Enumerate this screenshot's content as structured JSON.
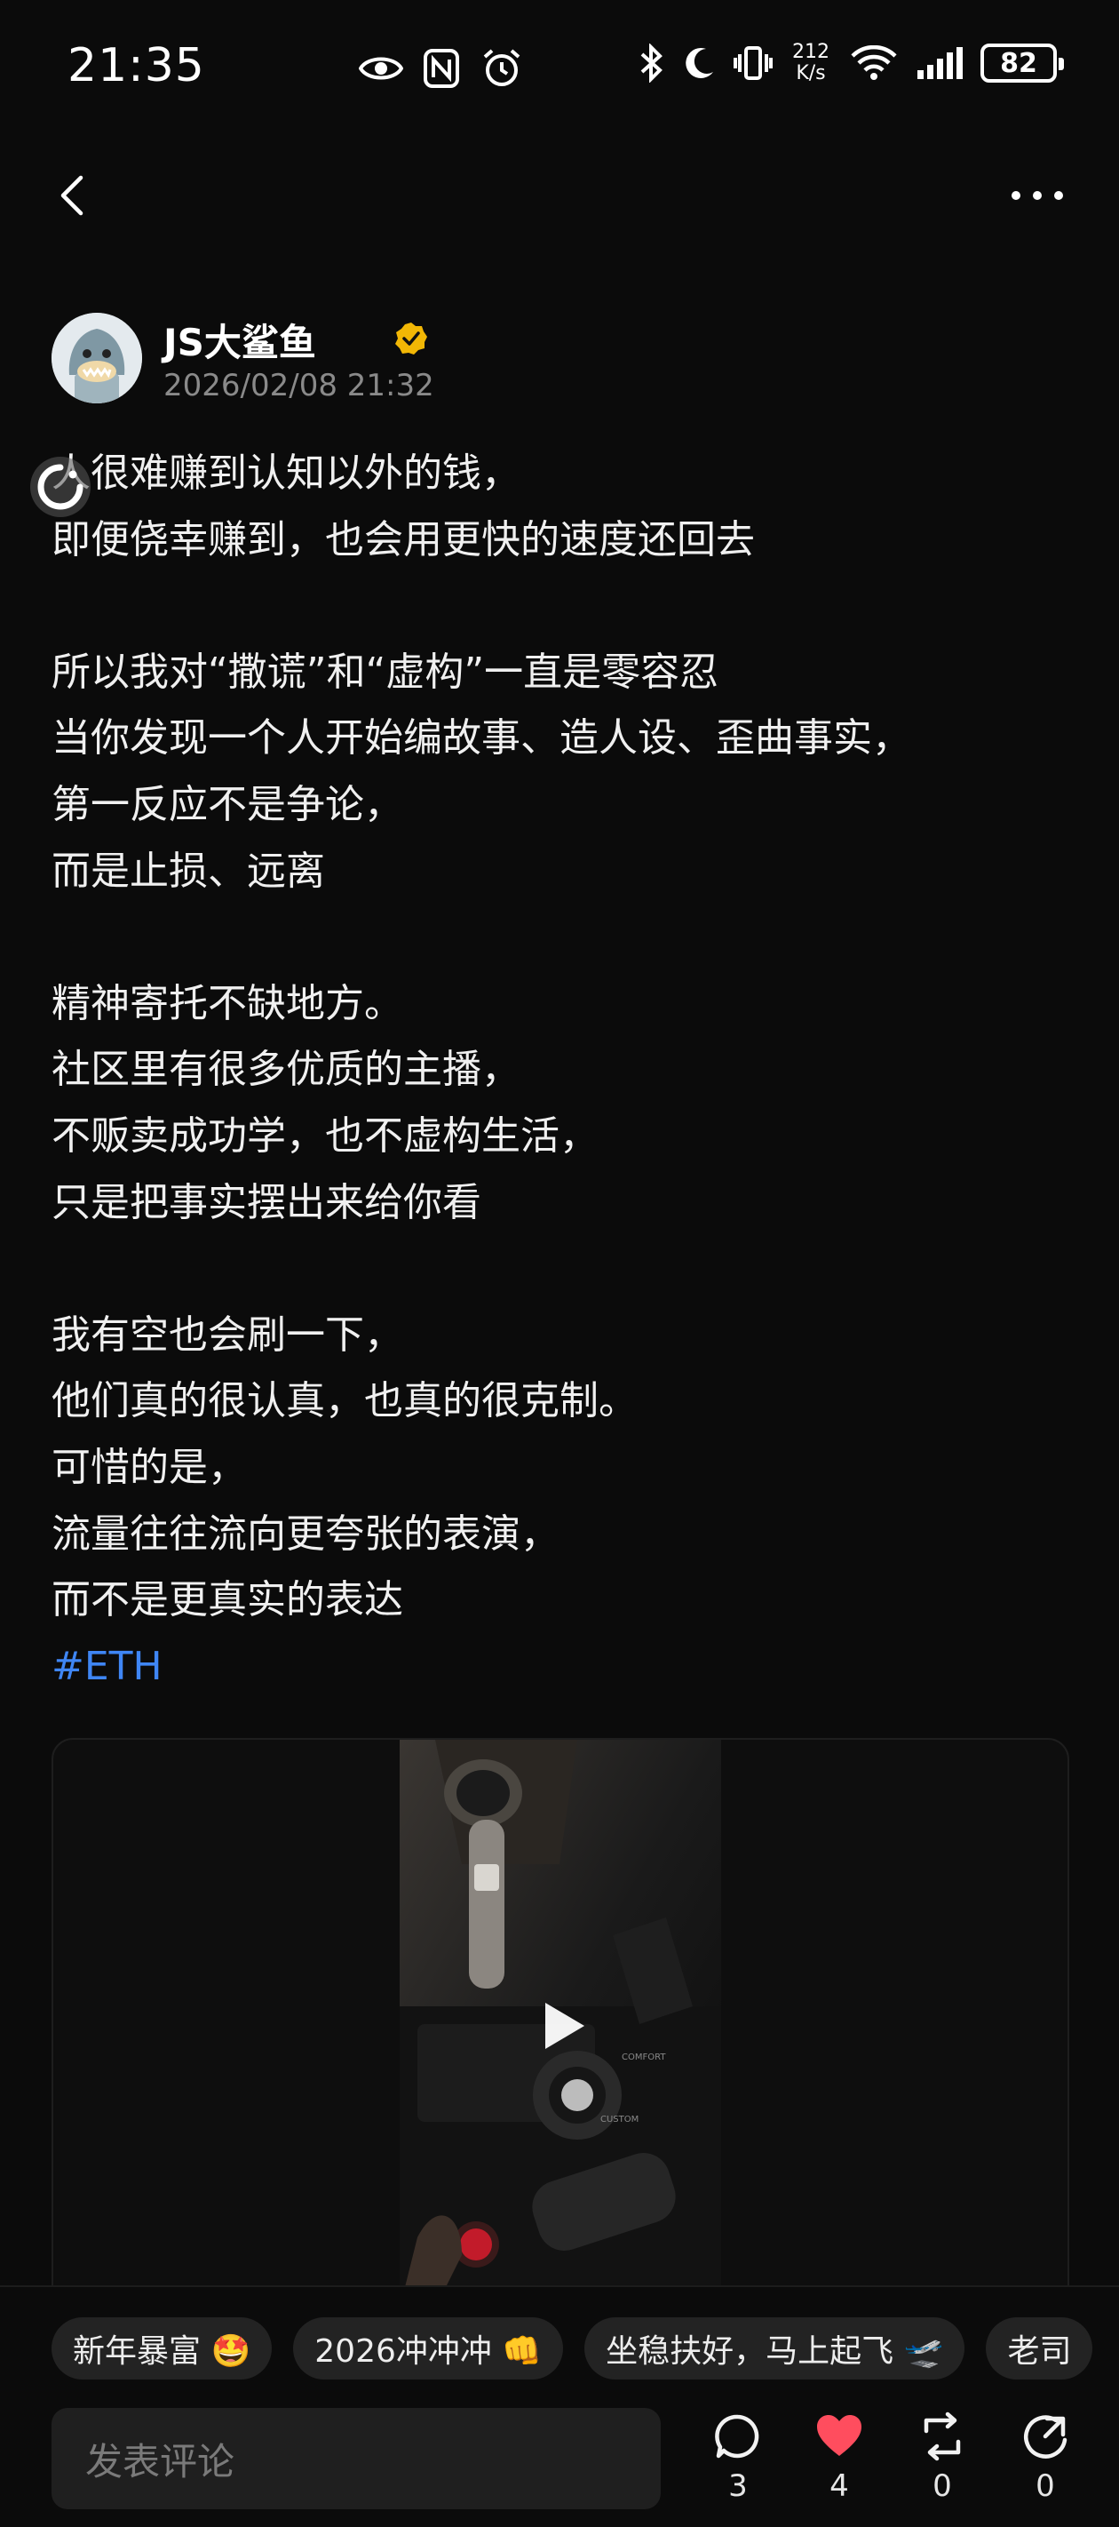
{
  "status_bar": {
    "time": "21:35",
    "net_speed_value": "212",
    "net_speed_unit": "K/s",
    "battery": "82",
    "icons": [
      "eye-icon",
      "nfc-icon",
      "alarm-icon",
      "bluetooth-icon",
      "moon-icon",
      "vibrate-icon",
      "wifi-icon",
      "signal-icon",
      "battery-icon"
    ]
  },
  "nav": {
    "back_icon": "chevron-left-icon",
    "more_icon": "more-dots-icon"
  },
  "author": {
    "name": "JS大鲨鱼",
    "time": "2026/02/08 21:32",
    "verified_color": "#f2b705"
  },
  "post": {
    "lines": [
      "人很难赚到认知以外的钱，",
      "即便侥幸赚到，也会用更快的速度还回去",
      "",
      "所以我对“撒谎”和“虚构”一直是零容忍",
      "当你发现一个人开始编故事、造人设、歪曲事实，",
      "第一反应不是争论，",
      "而是止损、远离",
      "",
      "精神寄托不缺地方。",
      "社区里有很多优质的主播，",
      "不贩卖成功学，也不虚构生活，",
      "只是把事实摆出来给你看",
      "",
      "我有空也会刷一下，",
      "他们真的很认真，也真的很克制。",
      "可惜的是，",
      "流量往往流向更夸张的表演，",
      "而不是更真实的表达"
    ],
    "hashtag": "#ETH",
    "hashtag_color": "#3f86f5"
  },
  "video": {
    "play_icon": "play-icon"
  },
  "tags": [
    "新年暴富 🤩",
    "2026冲冲冲 👊",
    "坐稳扶好，马上起飞 🛫",
    "老司"
  ],
  "comment": {
    "placeholder": "发表评论"
  },
  "actions": {
    "comments": "3",
    "likes": "4",
    "reposts": "0",
    "shares": "0",
    "like_color": "#ff4d5e"
  }
}
